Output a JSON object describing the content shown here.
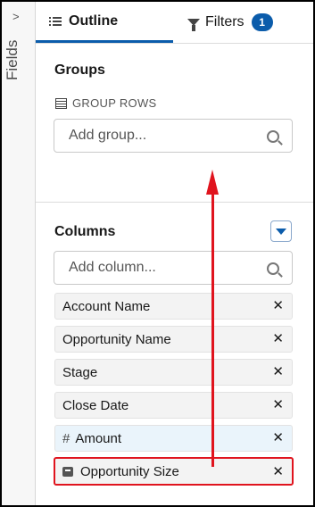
{
  "rail": {
    "label": "Fields",
    "toggle": ">"
  },
  "tabs": [
    {
      "label": "Outline",
      "active": true
    },
    {
      "label": "Filters",
      "badge": "1"
    }
  ],
  "groups": {
    "title": "Groups",
    "sub_label": "GROUP ROWS",
    "placeholder": "Add group..."
  },
  "columns": {
    "title": "Columns",
    "placeholder": "Add column...",
    "items": [
      {
        "label": "Account Name",
        "type_icon": ""
      },
      {
        "label": "Opportunity Name",
        "type_icon": ""
      },
      {
        "label": "Stage",
        "type_icon": ""
      },
      {
        "label": "Close Date",
        "type_icon": ""
      },
      {
        "label": "Amount",
        "type_icon": "#"
      },
      {
        "label": "Opportunity Size",
        "type_icon": "bucket-icon"
      }
    ],
    "remove_label": "✕"
  },
  "colors": {
    "accent": "#0b5cab",
    "annotation_red": "#e0141e",
    "numeric_highlight": "#eaf4fb"
  }
}
